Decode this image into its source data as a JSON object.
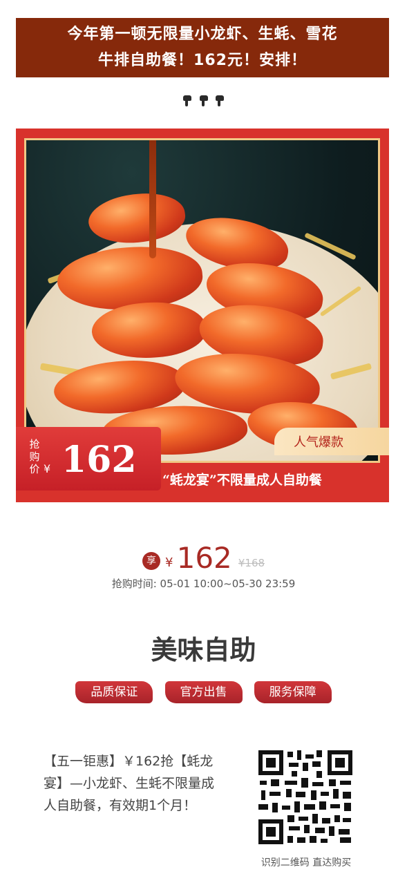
{
  "banner": {
    "line1": "今年第一顿无限量小龙虾、生蚝、雪花",
    "line2": "牛排自助餐！162元！安排！"
  },
  "emoji": {
    "name": "pointing-down-hand-icon",
    "count": 3
  },
  "product": {
    "ribbon_label": "抢购价",
    "ribbon_yen": "¥",
    "ribbon_price": "162",
    "hot_tag": "人气爆款",
    "slogan": "“蚝龙宴”不限量成人自助餐"
  },
  "price": {
    "badge": "享",
    "yen": "¥",
    "current": "162",
    "original": "¥168",
    "sale_time": "抢购时间: 05-01 10:00~05-30 23:59"
  },
  "section": {
    "title": "美味自助"
  },
  "tags": [
    "品质保证",
    "官方出售",
    "服务保障"
  ],
  "description": "【五一钜惠】￥162抢【蚝龙宴】—小龙虾、生蚝不限量成人自助餐，有效期1个月！",
  "qr": {
    "caption": "识别二维码 直达购买"
  },
  "colors": {
    "banner_bg": "#86290b",
    "accent": "#a82a24",
    "card_bg": "#d8322c"
  }
}
